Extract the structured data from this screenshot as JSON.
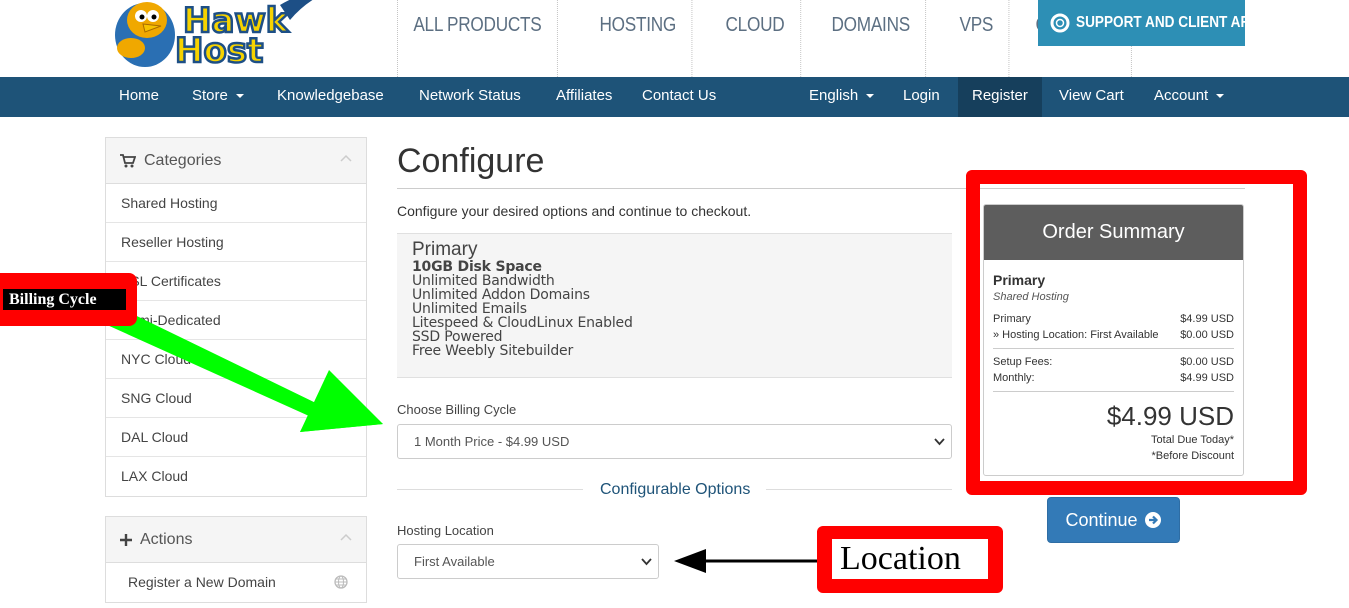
{
  "header": {
    "top_nav": [
      "ALL PRODUCTS",
      "HOSTING",
      "CLOUD",
      "DOMAINS",
      "VPS",
      "CONTACT"
    ],
    "support_button": "SUPPORT AND CLIENT AREA"
  },
  "mainnav": {
    "home": "Home",
    "store": "Store",
    "knowledgebase": "Knowledgebase",
    "network_status": "Network Status",
    "affiliates": "Affiliates",
    "contact_us": "Contact Us",
    "language": "English",
    "login": "Login",
    "register": "Register",
    "view_cart": "View Cart",
    "account": "Account"
  },
  "sidebar": {
    "categories_title": "Categories",
    "categories": [
      "Shared Hosting",
      "Reseller Hosting",
      "SSL Certificates",
      "Semi-Dedicated",
      "NYC Cloud",
      "SNG Cloud",
      "DAL Cloud",
      "LAX Cloud"
    ],
    "actions_title": "Actions",
    "actions": [
      "Register a New Domain"
    ]
  },
  "main": {
    "title": "Configure",
    "subtitle": "Configure your desired options and continue to checkout.",
    "product": {
      "name": "Primary",
      "features": [
        "10GB Disk Space",
        "Unlimited Bandwidth",
        "Unlimited Addon Domains",
        "Unlimited Emails",
        "Litespeed & CloudLinux Enabled",
        "SSD Powered",
        "Free Weebly Sitebuilder"
      ]
    },
    "billing_label": "Choose Billing Cycle",
    "billing_value": "1 Month Price - $4.99 USD",
    "config_options_title": "Configurable Options",
    "location_label": "Hosting Location",
    "location_value": "First Available"
  },
  "summary": {
    "title": "Order Summary",
    "product_name": "Primary",
    "product_group": "Shared Hosting",
    "lines": [
      {
        "label": "Primary",
        "value": "$4.99 USD"
      },
      {
        "label": "» Hosting Location: First Available",
        "value": "$0.00 USD"
      }
    ],
    "setup_label": "Setup Fees:",
    "setup_value": "$0.00 USD",
    "monthly_label": "Monthly:",
    "monthly_value": "$4.99 USD",
    "total": "$4.99 USD",
    "total_note": "Total Due Today*",
    "discount_note": "*Before Discount",
    "continue": "Continue"
  },
  "annotations": {
    "billing_cycle": "Billing Cycle",
    "location": "Location"
  },
  "colors": {
    "nav_bg": "#1e5378",
    "support_bg": "#2d8fb5",
    "continue_bg": "#337ab7",
    "annotation_red": "#ff0000",
    "annotation_green": "#00ff00"
  }
}
